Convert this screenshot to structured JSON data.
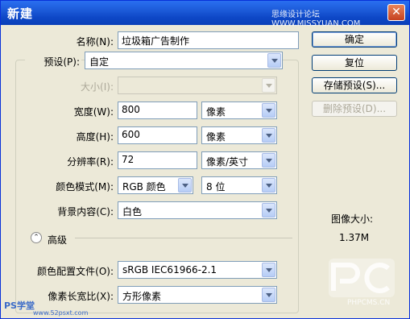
{
  "window": {
    "title": "新建",
    "watermark": "思缘设计论坛 WWW.MISSYUAN.COM",
    "close_glyph": "✕"
  },
  "form": {
    "name": {
      "label": "名称(N):",
      "value": "垃圾箱广告制作"
    },
    "preset": {
      "label": "预设(P):",
      "value": "自定"
    },
    "size": {
      "label": "大小(I):",
      "value": ""
    },
    "width": {
      "label": "宽度(W):",
      "value": "800",
      "unit": "像素"
    },
    "height": {
      "label": "高度(H):",
      "value": "600",
      "unit": "像素"
    },
    "resolution": {
      "label": "分辨率(R):",
      "value": "72",
      "unit": "像素/英寸"
    },
    "color_mode": {
      "label": "颜色模式(M):",
      "value": "RGB 颜色",
      "depth": "8 位"
    },
    "background": {
      "label": "背景内容(C):",
      "value": "白色"
    },
    "advanced": {
      "label": "高级",
      "toggle_glyph": "⌃"
    },
    "color_profile": {
      "label": "颜色配置文件(O):",
      "value": "sRGB IEC61966-2.1"
    },
    "pixel_aspect": {
      "label": "像素长宽比(X):",
      "value": "方形像素"
    }
  },
  "buttons": {
    "ok": "确定",
    "reset": "复位",
    "save_preset": "存储预设(S)...",
    "delete_preset": "删除预设(D)..."
  },
  "image_size": {
    "label": "图像大小:",
    "value": "1.37M"
  },
  "watermarks": {
    "ps": "PS学堂",
    "ps_site": "www.52psxt.com",
    "pc": "PHPCMS.CN"
  },
  "colors": {
    "titlebar": "#0a3fb8",
    "dialog_bg": "#ece9d8",
    "field_border": "#7f9db9"
  }
}
